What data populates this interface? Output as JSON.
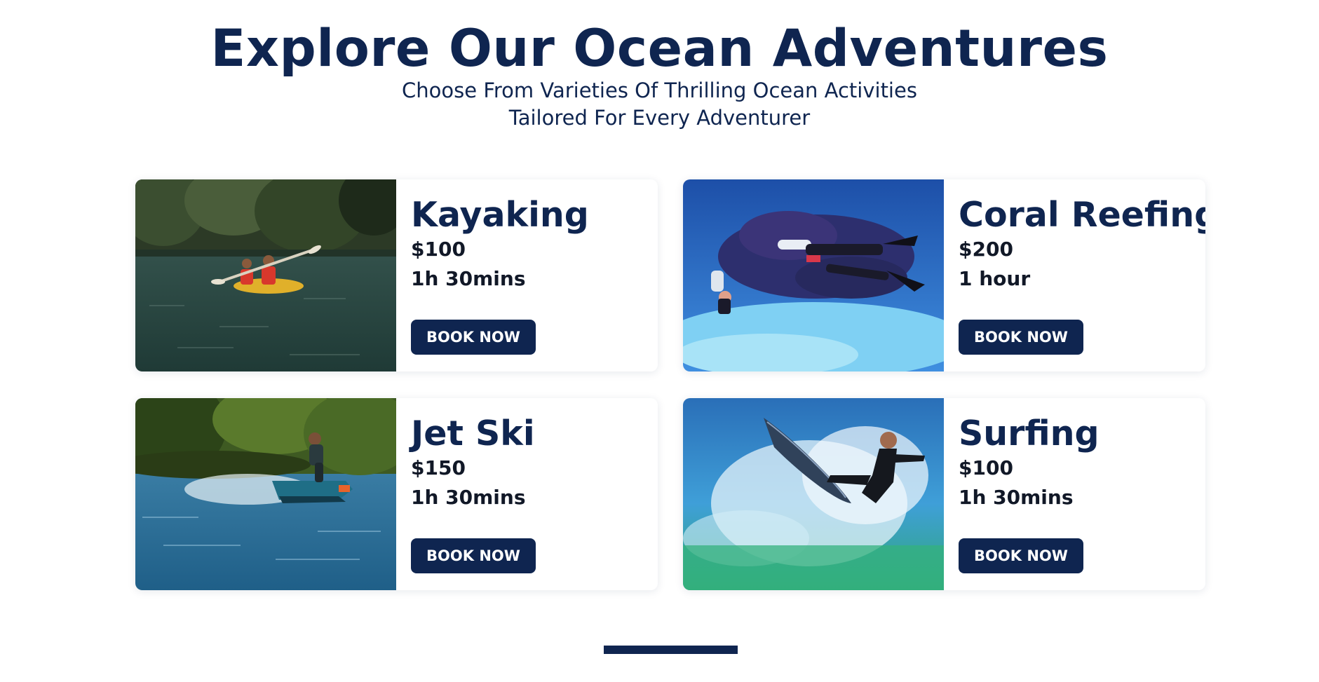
{
  "header": {
    "title": "Explore Our Ocean Adventures",
    "subtitle_line1": "Choose From Varieties Of Thrilling Ocean Activities",
    "subtitle_line2": "Tailored For Every Adventurer"
  },
  "colors": {
    "brand_navy": "#0f2550",
    "text_dark": "#111827",
    "background": "#ffffff"
  },
  "activities": [
    {
      "title": "Kayaking",
      "price": "$100",
      "duration": "1h 30mins",
      "button_label": "BOOK NOW",
      "image_subject": "kayaking-photo"
    },
    {
      "title": "Coral Reefing",
      "price": "$200",
      "duration": "1 hour",
      "button_label": "BOOK NOW",
      "image_subject": "scuba-diving-photo"
    },
    {
      "title": "Jet Ski",
      "price": "$150",
      "duration": "1h 30mins",
      "button_label": "BOOK NOW",
      "image_subject": "jet-ski-photo"
    },
    {
      "title": "Surfing",
      "price": "$100",
      "duration": "1h 30mins",
      "button_label": "BOOK NOW",
      "image_subject": "surfing-photo"
    }
  ]
}
